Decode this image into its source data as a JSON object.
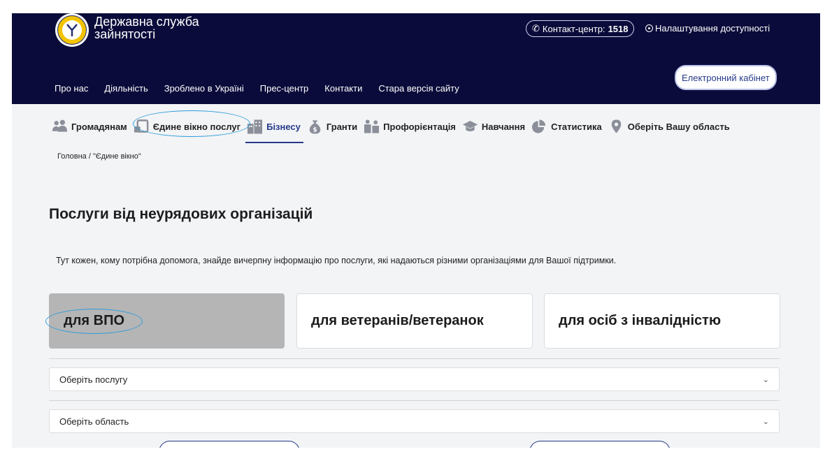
{
  "header": {
    "org_name": "Державна служба\nзайнятості",
    "logo_text": "ДЕРЖАВНА СЛУЖБА ЗАЙНЯТОСТІ",
    "contact_label": "Контакт-центр:",
    "contact_number": "1518",
    "accessibility": "Налаштування доступності",
    "cabinet_button": "Електронний кабінет",
    "nav": [
      "Про нас",
      "Діяльність",
      "Зроблено в Україні",
      "Прес-центр",
      "Контакти",
      "Стара версія сайту"
    ]
  },
  "categories": [
    {
      "label": "Громадянам",
      "icon": "people-icon"
    },
    {
      "label": "Єдине вікно послуг",
      "icon": "window-icon"
    },
    {
      "label": "Бізнесу",
      "icon": "buildings-icon",
      "active": true
    },
    {
      "label": "Гранти",
      "icon": "money-bag-icon"
    },
    {
      "label": "Профорієнтація",
      "icon": "career-icon"
    },
    {
      "label": "Навчання",
      "icon": "graduation-cap-icon"
    },
    {
      "label": "Статистика",
      "icon": "pie-chart-icon"
    },
    {
      "label": "Оберіть Вашу область",
      "icon": "map-pin-icon"
    }
  ],
  "breadcrumb": "Головна / \"Єдине вікно\"",
  "page_title": "Послуги від неурядових організацій",
  "description": "Тут кожен, кому потрібна допомога, знайде вичерпну інформацію про послуги, які надаються різними організаціями для Вашої підтримки.",
  "tiles": [
    {
      "label": "для ВПО",
      "selected": true
    },
    {
      "label": "для ветеранів/ветеранок",
      "selected": false
    },
    {
      "label": "для осіб з інвалідністю",
      "selected": false
    }
  ],
  "selects": {
    "service_placeholder": "Оберіть послугу",
    "region_placeholder": "Оберіть область"
  },
  "colors": {
    "header_bg": "#0b0b3b",
    "accent": "#253a8a",
    "annotation": "#2d9cdb",
    "selected_tile": "#b5b5b5"
  }
}
